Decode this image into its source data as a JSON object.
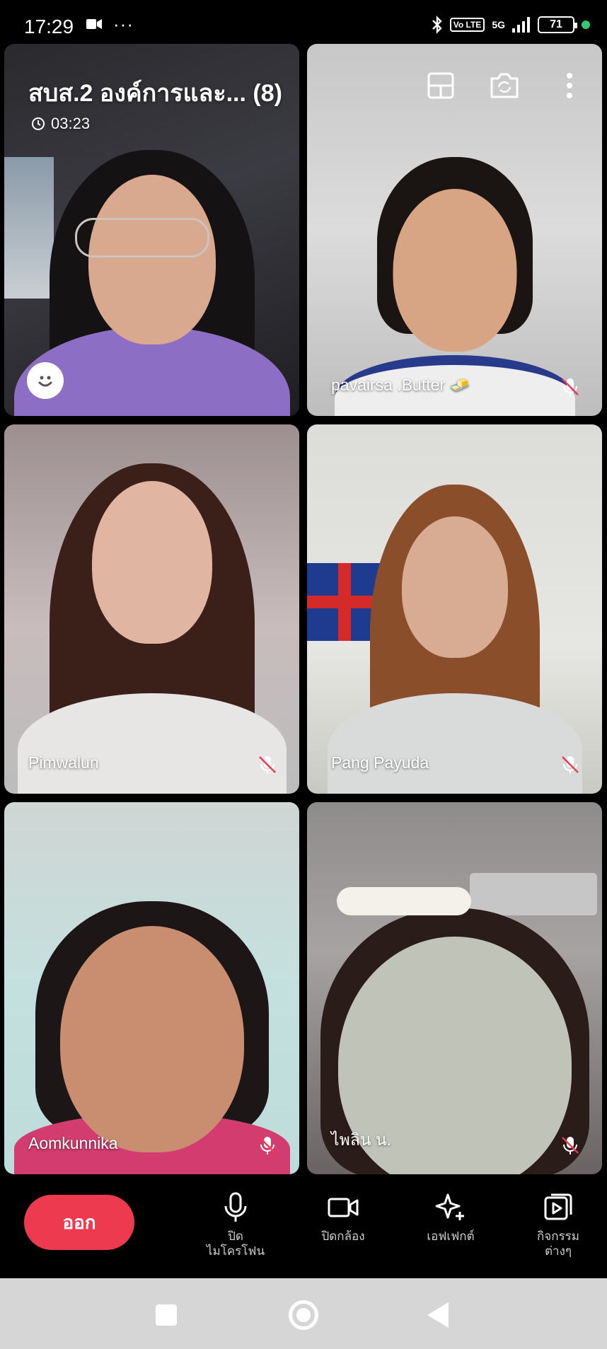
{
  "status_bar": {
    "time": "17:29",
    "battery": "71",
    "network": "5G",
    "volte": "Vo LTE"
  },
  "call": {
    "title": "สบส.2 องค์การและ... (8)",
    "duration": "03:23"
  },
  "participants": [
    {
      "name": "",
      "muted": false
    },
    {
      "name": "pavairsa .Butter 🧈",
      "muted": true
    },
    {
      "name": "Pimwalun",
      "muted": true
    },
    {
      "name": "Pang Payuda",
      "muted": true
    },
    {
      "name": "Aomkunnika",
      "muted": true
    },
    {
      "name": "ไพลิน น.",
      "muted": true
    }
  ],
  "controls": {
    "leave": "ออก",
    "mic": "ปิด\nไมโครโฟน",
    "camera": "ปิดกล้อง",
    "effects": "เอฟเฟกต์",
    "activities": "กิจกรรม\nต่างๆ"
  },
  "colors": {
    "leave_button": "#ee3a4f",
    "background": "#000000",
    "nav_bar": "#d6d6d6"
  }
}
